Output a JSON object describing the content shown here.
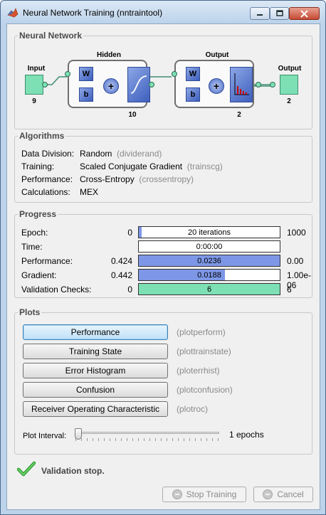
{
  "window": {
    "title": "Neural Network Training (nntraintool)"
  },
  "network": {
    "section_title": "Neural Network",
    "input_label": "Input",
    "input_size": "9",
    "hidden_label": "Hidden",
    "hidden_size": "10",
    "output_layer_label": "Output",
    "output_layer_size": "2",
    "output_label": "Output",
    "output_size": "2",
    "weight_symbol": "W",
    "bias_symbol": "b",
    "sum_symbol": "+"
  },
  "algorithms": {
    "section_title": "Algorithms",
    "rows": [
      {
        "key": "Data Division:",
        "value": "Random",
        "detail": "(dividerand)"
      },
      {
        "key": "Training:",
        "value": "Scaled Conjugate Gradient",
        "detail": "(trainscg)"
      },
      {
        "key": "Performance:",
        "value": "Cross-Entropy",
        "detail": "(crossentropy)"
      },
      {
        "key": "Calculations:",
        "value": "MEX",
        "detail": ""
      }
    ]
  },
  "progress": {
    "section_title": "Progress",
    "rows": [
      {
        "label": "Epoch:",
        "start": "0",
        "current": "20 iterations",
        "end": "1000",
        "fill": 0.02,
        "color": "#7d97e6"
      },
      {
        "label": "Time:",
        "start": "",
        "current": "0:00:00",
        "end": "",
        "fill": 0,
        "color": "#7d97e6"
      },
      {
        "label": "Performance:",
        "start": "0.424",
        "current": "0.0236",
        "end": "0.00",
        "fill": 1.0,
        "color": "#7d97e6"
      },
      {
        "label": "Gradient:",
        "start": "0.442",
        "current": "0.0188",
        "end": "1.00e-06",
        "fill": 0.61,
        "color": "#7d97e6"
      },
      {
        "label": "Validation Checks:",
        "start": "0",
        "current": "6",
        "end": "6",
        "fill": 1.0,
        "color": "#7de0b4"
      }
    ]
  },
  "plots": {
    "section_title": "Plots",
    "buttons": [
      {
        "label": "Performance",
        "fn": "(plotperform)"
      },
      {
        "label": "Training State",
        "fn": "(plottrainstate)"
      },
      {
        "label": "Error Histogram",
        "fn": "(ploterrhist)"
      },
      {
        "label": "Confusion",
        "fn": "(plotconfusion)"
      },
      {
        "label": "Receiver Operating Characteristic",
        "fn": "(plotroc)"
      }
    ],
    "interval_label": "Plot Interval:",
    "interval_value": "1 epochs"
  },
  "status": {
    "text": "Validation stop."
  },
  "actions": {
    "stop_label": "Stop Training",
    "cancel_label": "Cancel"
  }
}
